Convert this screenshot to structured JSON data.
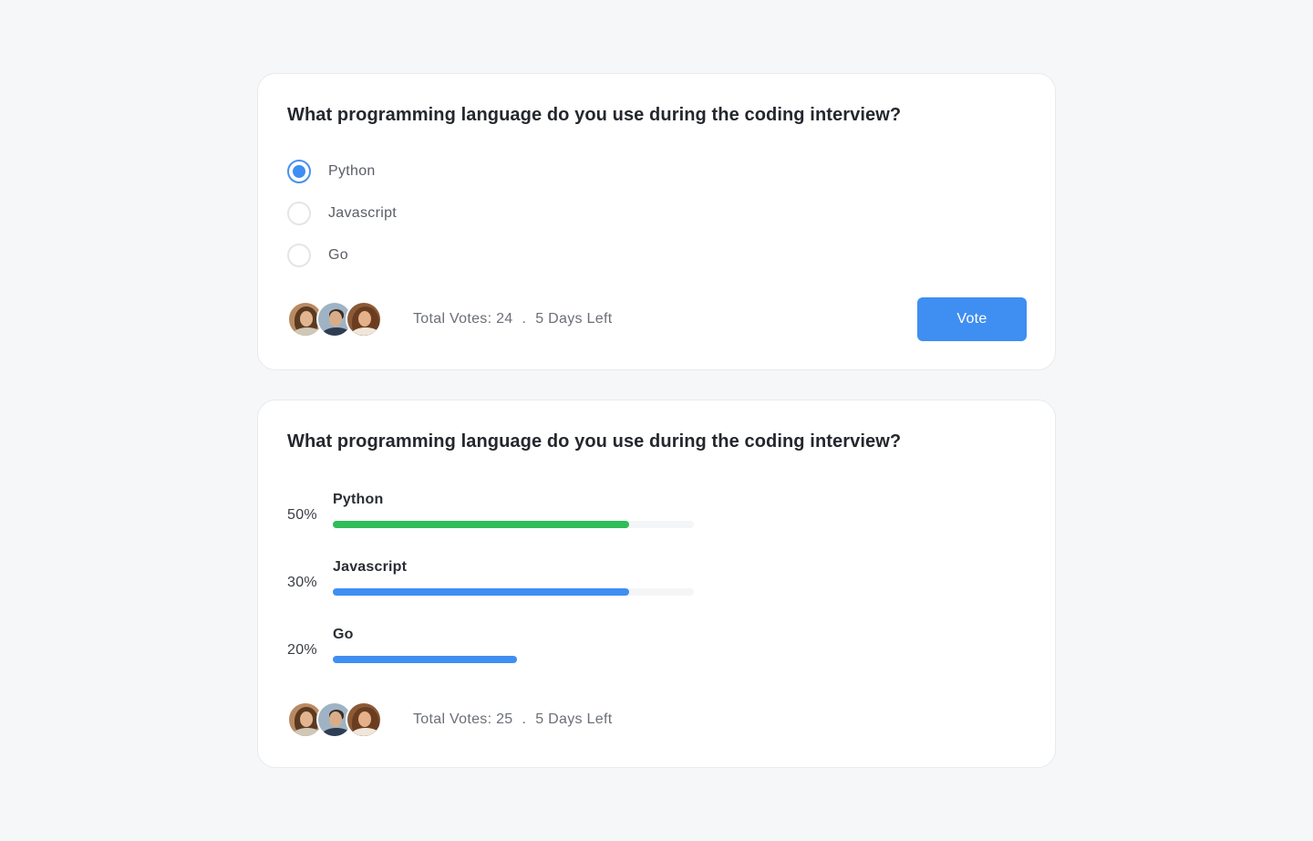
{
  "colors": {
    "accent": "#3f8ef2",
    "success": "#2ebd59",
    "background": "#f6f7f9",
    "card": "#ffffff"
  },
  "vote_card": {
    "question": "What programming language do you use during the coding interview?",
    "options": [
      {
        "label": "Python",
        "selected": true
      },
      {
        "label": "Javascript",
        "selected": false
      },
      {
        "label": "Go",
        "selected": false
      }
    ],
    "total_votes": "Total Votes: 24",
    "separator": ".",
    "time_left": "5 Days Left",
    "vote_button_label": "Vote",
    "avatars": [
      "avatar-woman-icon",
      "avatar-man-icon",
      "avatar-woman-curly-icon"
    ]
  },
  "results_card": {
    "question": "What programming language do you use during the coding interview?",
    "results": [
      {
        "label": "Python",
        "percent_label": "50%",
        "fill_fraction": 0.82,
        "color": "#2ebd59"
      },
      {
        "label": "Javascript",
        "percent_label": "30%",
        "fill_fraction": 0.82,
        "color": "#3f8ef2"
      },
      {
        "label": "Go",
        "percent_label": "20%",
        "fill_fraction": 0.51,
        "color": "#3f8ef2"
      }
    ],
    "total_votes": "Total Votes: 25",
    "separator": ".",
    "time_left": "5 Days Left",
    "avatars": [
      "avatar-woman-icon",
      "avatar-man-icon",
      "avatar-woman-curly-icon"
    ]
  }
}
